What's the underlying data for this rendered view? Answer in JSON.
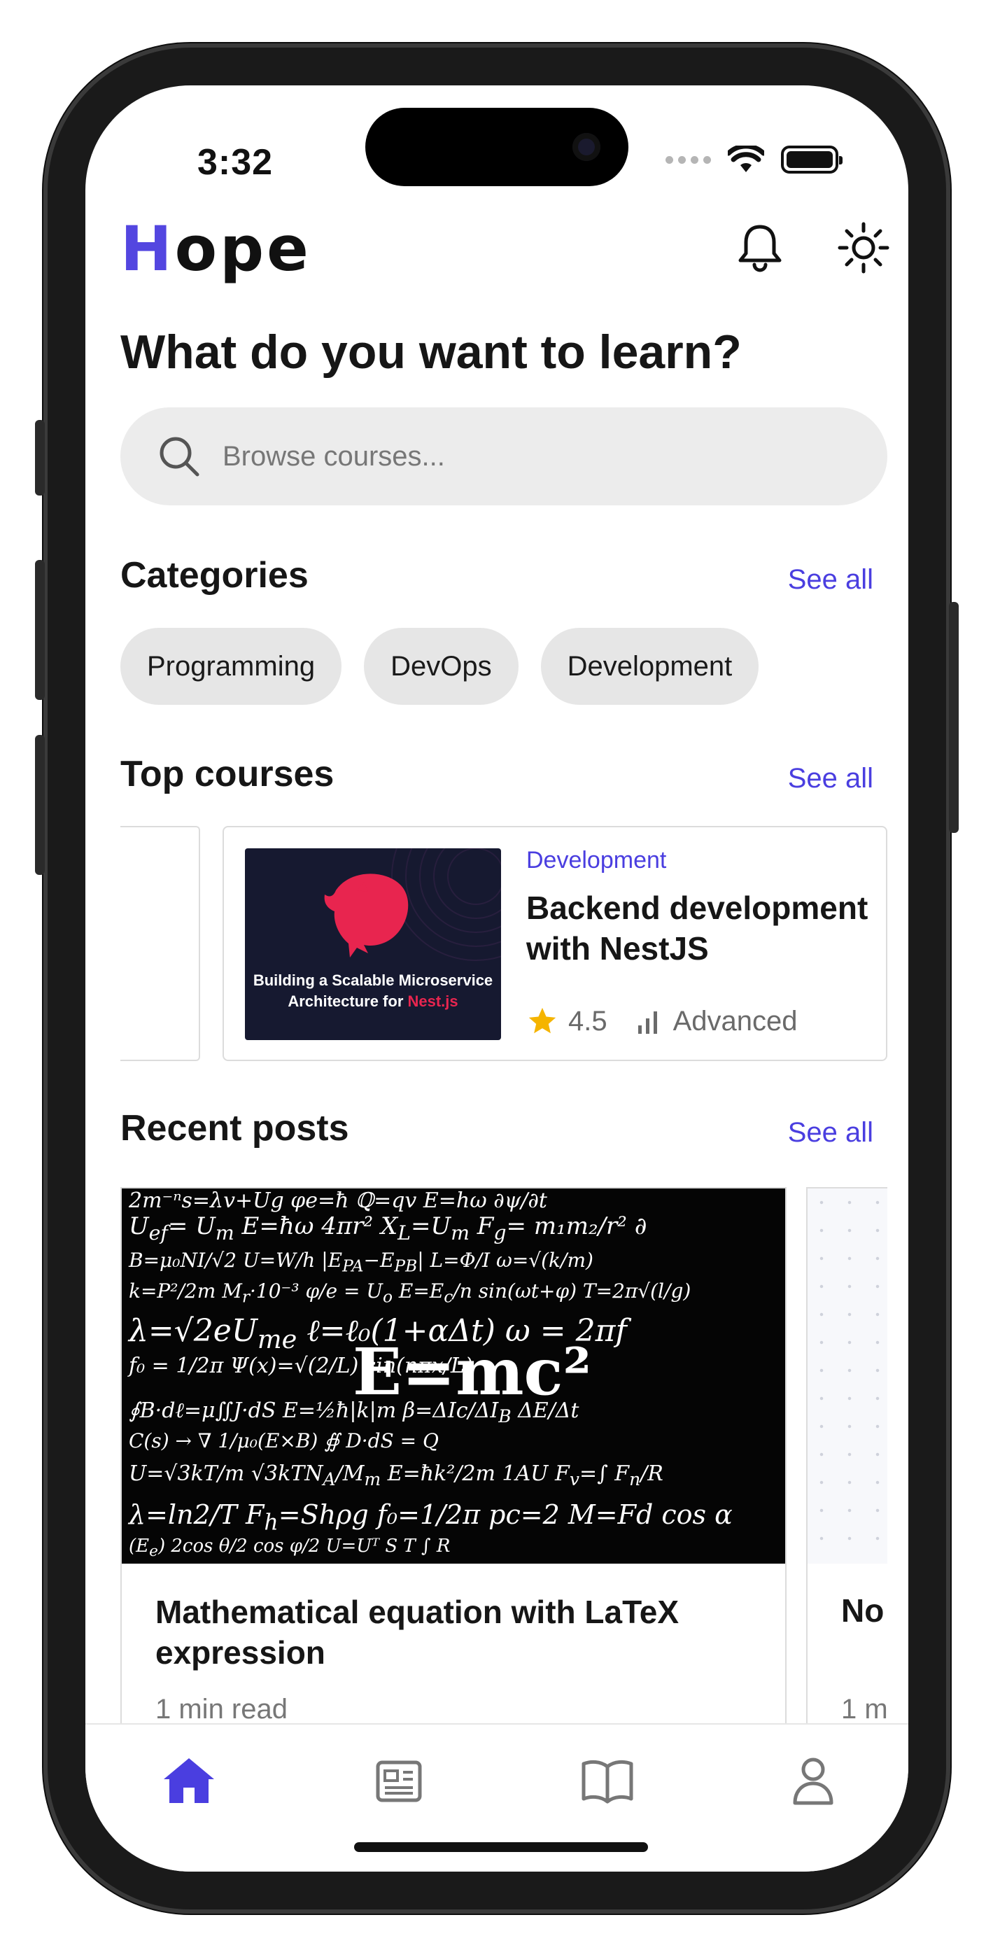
{
  "status_bar": {
    "time": "3:32"
  },
  "header": {
    "logo_first": "H",
    "logo_rest": "ope",
    "icons": [
      "bell-icon",
      "sun-icon"
    ]
  },
  "headline": "What do you want to learn?",
  "search": {
    "placeholder": "Browse courses...",
    "icon": "search-icon"
  },
  "categories": {
    "title": "Categories",
    "see_all": "See all",
    "items": [
      "Programming",
      "DevOps",
      "Development"
    ]
  },
  "top_courses": {
    "title": "Top courses",
    "see_all": "See all",
    "items": [
      {
        "category": "Development",
        "title": "Backend development with NestJS",
        "rating": "4.5",
        "level": "Advanced",
        "thumb_caption_line1": "Building a Scalable Microservice",
        "thumb_caption_line2_prefix": "Architecture for ",
        "thumb_caption_line2_brand": "Nest.js"
      }
    ]
  },
  "recent_posts": {
    "title": "Recent posts",
    "see_all": "See all",
    "items": [
      {
        "title": "Mathematical equation with LaTeX expression",
        "read_time": "1 min read"
      },
      {
        "title": "No",
        "read_time": "1 m"
      }
    ]
  },
  "bottom_nav": {
    "items": [
      "home-icon",
      "news-icon",
      "book-icon",
      "profile-icon"
    ],
    "active": "home-icon"
  },
  "colors": {
    "accent": "#4a3ee0",
    "chip_bg": "#e6e6e6",
    "search_bg": "#ececec",
    "star": "#f5b400"
  }
}
